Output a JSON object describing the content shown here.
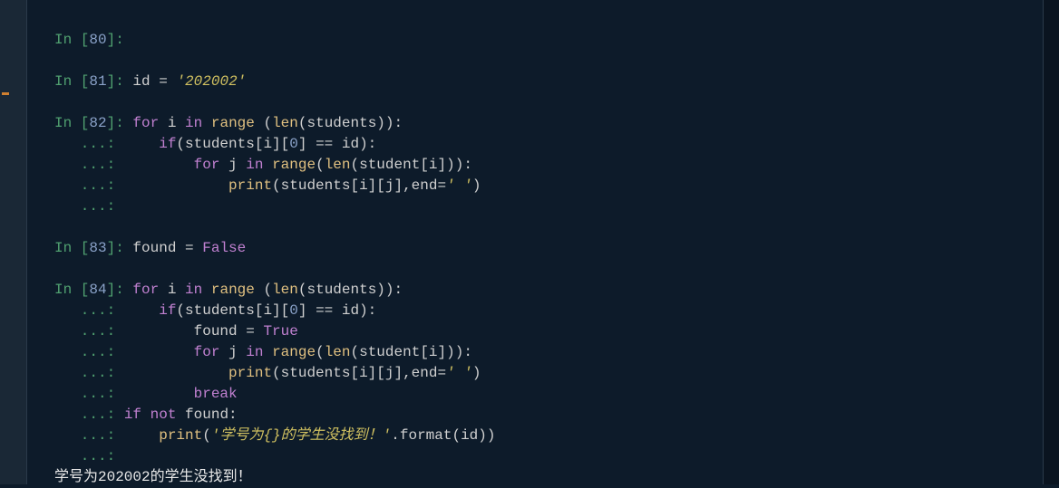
{
  "cells": {
    "c80": {
      "prompt": "In [",
      "num": "80",
      "close": "]: "
    },
    "c81": {
      "prompt": "In [",
      "num": "81",
      "close": "]: ",
      "assign_l": "id ",
      "op": "=",
      "sp": " ",
      "str": "'202002'"
    },
    "c82": {
      "prompt": "In [",
      "num": "82",
      "close": "]: ",
      "for1": "for",
      "sp1": " i ",
      "in1": "in",
      "sp2": " ",
      "range1": "range",
      "args1": " (",
      "len1": "len",
      "args1b": "(students)):",
      "cont": "   ...: ",
      "if1": "if",
      "ifbody": "(students[i][",
      "zero": "0",
      "ifbody2": "] ",
      "eq": "==",
      "ifbody3": " id):",
      "for2": "for",
      "sp3": " j ",
      "in2": "in",
      "sp4": " ",
      "range2": "range",
      "p1": "(",
      "len2": "len",
      "args2": "(student[i])):",
      "print1": "print",
      "printargs": "(students[i][j],end",
      "eq2": "=",
      "str1": "' '",
      "close1": ")"
    },
    "c83": {
      "prompt": "In [",
      "num": "83",
      "close": "]: ",
      "assign_l": "found ",
      "op": "=",
      "sp": " ",
      "val": "False"
    },
    "c84": {
      "prompt": "In [",
      "num": "84",
      "close": "]: ",
      "for1": "for",
      "sp1": " i ",
      "in1": "in",
      "sp2": " ",
      "range1": "range",
      "args1": " (",
      "len1": "len",
      "args1b": "(students)):",
      "cont": "   ...: ",
      "if1": "if",
      "ifbody": "(students[i][",
      "zero": "0",
      "ifbody2": "] ",
      "eq": "==",
      "ifbody3": " id):",
      "found_l": "found ",
      "found_op": "=",
      "sp_f": " ",
      "true": "True",
      "for2": "for",
      "sp3": " j ",
      "in2": "in",
      "sp4": " ",
      "range2": "range",
      "p1": "(",
      "len2": "len",
      "args2": "(student[i])):",
      "print1": "print",
      "printargs": "(students[i][j],end",
      "eq2": "=",
      "str1": "' '",
      "close1": ")",
      "break": "break",
      "if2": "if",
      "not": " not ",
      "found2": "found:",
      "print2": "print",
      "po": "(",
      "str2": "'学号为{}的学生没找到！'",
      "fmt": ".format(id))"
    },
    "output": "学号为202002的学生没找到！"
  }
}
